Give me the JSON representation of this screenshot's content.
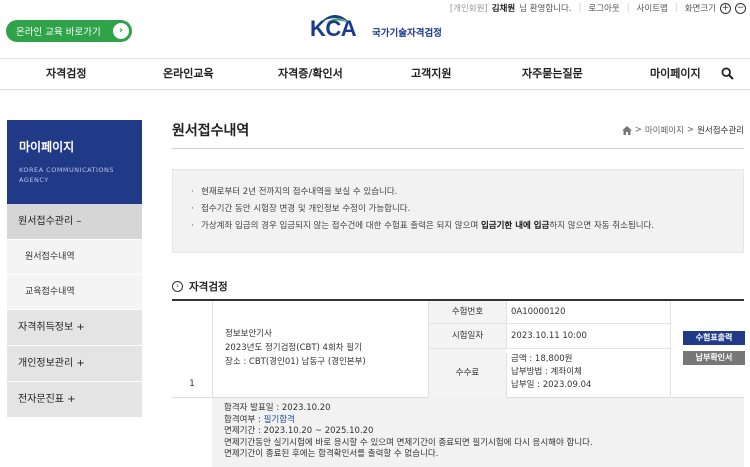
{
  "util": {
    "member_type": "[개인회원]",
    "user_name": "김채원",
    "greeting": "님 환영합니다.",
    "logout": "로그아웃",
    "sitemap": "사이트맵",
    "zoom_label": "화면크기",
    "zoom_in": "+",
    "zoom_out": "−"
  },
  "edu_button": {
    "label": "온라인 교육 바로가기",
    "arrow": "›"
  },
  "logo": {
    "mark": "KCA",
    "name": "국가기술자격검정"
  },
  "gnb": [
    "자격검정",
    "온라인교육",
    "자격증/확인서",
    "고객지원",
    "자주묻는질문",
    "마이페이지"
  ],
  "lnb": {
    "title": "마이페이지",
    "subtitle_1": "KOREA COMMUNICATIONS",
    "subtitle_2": "AGENCY",
    "menu_1": "원서접수관리 –",
    "sub_1": "원서접수내역",
    "sub_2": "교육접수내역",
    "menu_2": "자격취득정보 +",
    "menu_3": "개인정보관리 +",
    "menu_4": "전자문진표 +"
  },
  "page": {
    "title": "원서접수내역",
    "crumb_1": "마이페이지",
    "crumb_2": "원서접수관리",
    "crumb_sep": ">"
  },
  "notice": {
    "line1": "현재로부터 2년 전까지의 접수내역을 보실 수 있습니다.",
    "line2": "접수기간 동안 시험장 변경 및 개인정보 수정이 가능합니다.",
    "line3_a": "가상계좌 입금의 경우 입금되지 않는 접수건에 대한 수험표 출력은 되지 않으며 ",
    "line3_b": "입금기한 내에 입금",
    "line3_c": "하지 않으면 자동 취소됩니다."
  },
  "section": {
    "title": "자격검정",
    "icon": "›"
  },
  "record": {
    "no": "1",
    "exam_name": "정보보안기사",
    "exam_round": "2023년도 정기검정(CBT) 4회차 필기",
    "exam_place": "장소 : CBT(경인01) 남동구 (경인본부)",
    "label_number": "수험번호",
    "number": "0A10000120",
    "label_date": "시험일자",
    "date": "2023.10.11 10:00",
    "label_fee": "수수료",
    "fee_amount": "금액 : 18,800원",
    "fee_method": "납부방법 : 계좌이체",
    "fee_date": "납부일 : 2023.09.04",
    "btn_ticket": "수험표출력",
    "btn_receipt": "납부확인서"
  },
  "result": {
    "announce": "합격자 발표일 : 2023.10.20",
    "pass_label": "합격여부 : ",
    "pass_value": "필기합격",
    "exempt": "면제기간 : 2023.10.20 ~ 2025.10.20",
    "note1": "면제기간동안 실기시험에 바로 응시할 수 있으며 면제기간이 종료되면 필기시험에 다시 응시해야 합니다.",
    "note2": "면제기간이 종료된 후에는 합격확인서를 출력할 수 없습니다."
  }
}
